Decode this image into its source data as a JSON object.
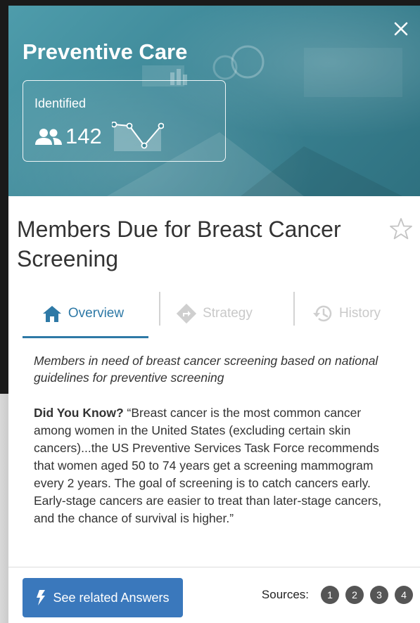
{
  "hero": {
    "title": "Preventive Care",
    "stat": {
      "label": "Identified",
      "value": "142",
      "icon": "people-icon",
      "trend_icon": "sparkline-chart-icon"
    },
    "close_icon": "close-icon"
  },
  "screen": {
    "title": "Members Due for Breast Cancer Screening",
    "favorite_icon": "star-outline-icon"
  },
  "tabs": [
    {
      "label": "Overview",
      "icon": "home-icon",
      "active": true
    },
    {
      "label": "Strategy",
      "icon": "direction-sign-icon",
      "active": false
    },
    {
      "label": "History",
      "icon": "history-clock-icon",
      "active": false
    }
  ],
  "overview": {
    "description": "Members in need of breast cancer screening based on national guidelines for preventive screening",
    "did_you_know_label": "Did You Know?",
    "did_you_know_text": "“Breast cancer is the most common cancer among women in the United States (excluding certain skin cancers)...the US Preventive Services Task Force recommends that women aged 50 to 74 years get a screening mammogram every 2 years. The goal of screening is to catch cancers early. Early-stage cancers are easier to treat than later-stage cancers, and the chance of survival is higher.”"
  },
  "footer": {
    "answers_button": "See related Answers",
    "answers_icon": "lightning-bolt-icon",
    "sources_label": "Sources:",
    "sources": [
      "1",
      "2",
      "3",
      "4"
    ]
  },
  "colors": {
    "hero_teal": "#3d8797",
    "accent_blue": "#2e79a6",
    "button_blue": "#3a78bc",
    "source_chip": "#555555"
  }
}
